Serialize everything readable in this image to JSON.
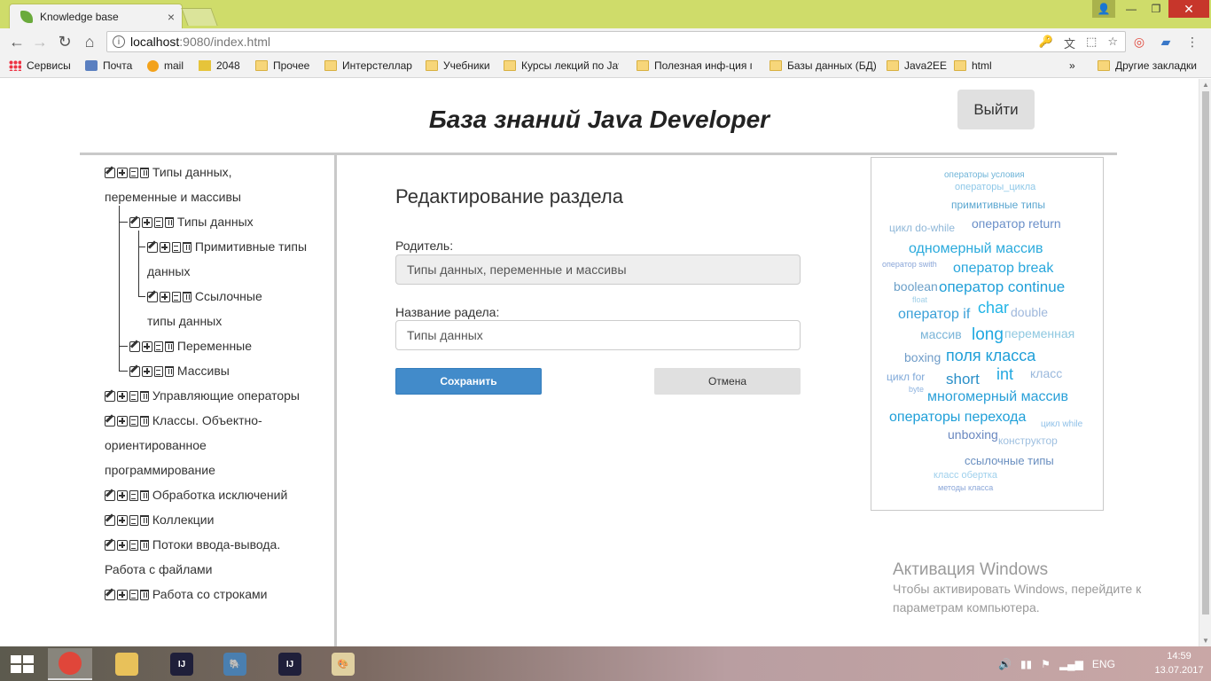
{
  "browser": {
    "tab_title": "Knowledge base",
    "tab_close": "×",
    "url_host": "localhost",
    "url_rest": ":9080/index.html",
    "window_buttons": {
      "user": "👤",
      "minimize": "—",
      "maximize": "❐",
      "close": "✕"
    },
    "nav": {
      "back": "←",
      "forward": "→",
      "reload": "↻",
      "home": "⌂"
    },
    "info_icon": "i",
    "omnibox_icons": {
      "key": "🔑",
      "translate": "文",
      "cast": "⬚",
      "star": "☆"
    }
  },
  "bookmarks": {
    "items": [
      {
        "label": "Сервисы",
        "icon": "apps-icon"
      },
      {
        "label": "Почта",
        "icon": "mail-icon"
      },
      {
        "label": "mail",
        "icon": "at-icon"
      },
      {
        "label": "2048",
        "icon": "game-icon"
      },
      {
        "label": "Прочее",
        "icon": "folder-icon"
      },
      {
        "label": "Интерстеллар",
        "icon": "folder-icon"
      },
      {
        "label": "Учебники",
        "icon": "folder-icon"
      },
      {
        "label": "Курсы лекций по Jav",
        "icon": "folder-icon"
      },
      {
        "label": "Полезная инф-ция п",
        "icon": "folder-icon"
      },
      {
        "label": "Базы данных (БД)",
        "icon": "folder-icon"
      },
      {
        "label": "Java2EE",
        "icon": "folder-icon"
      },
      {
        "label": "html",
        "icon": "folder-icon"
      }
    ],
    "more": "»",
    "other": "Другие закладки"
  },
  "page": {
    "title": "База знаний Java Developer",
    "logout_label": "Выйти"
  },
  "tree": {
    "items": [
      {
        "lines": [
          "Типы данных,",
          "переменные и массивы"
        ],
        "level": 0
      },
      {
        "lines": [
          "Типы данных"
        ],
        "level": 1
      },
      {
        "lines": [
          "Примитивные типы",
          "данных"
        ],
        "level": 2
      },
      {
        "lines": [
          "Ссылочные",
          "типы данных"
        ],
        "level": 2
      },
      {
        "lines": [
          "Переменные"
        ],
        "level": 1
      },
      {
        "lines": [
          "Массивы"
        ],
        "level": 1
      },
      {
        "lines": [
          "Управляющие операторы"
        ],
        "level": 0
      },
      {
        "lines": [
          "Классы. Объектно-",
          "ориентированное",
          "программирование"
        ],
        "level": 0
      },
      {
        "lines": [
          "Обработка исключений"
        ],
        "level": 0
      },
      {
        "lines": [
          "Коллекции"
        ],
        "level": 0
      },
      {
        "lines": [
          "Потоки ввода-вывода.",
          "Работа с файлами"
        ],
        "level": 0
      },
      {
        "lines": [
          "Работа со строками"
        ],
        "level": 0
      }
    ]
  },
  "form": {
    "title": "Редактирование раздела",
    "parent_label": "Родитель:",
    "parent_value": "Типы данных, переменные и массивы",
    "name_label": "Название радела:",
    "name_value": "Типы данных",
    "save_label": "Сохранить",
    "cancel_label": "Отмена"
  },
  "tag_cloud": {
    "tags": [
      {
        "text": "операторы условия",
        "color": "#6fb4d8",
        "size": 10
      },
      {
        "text": "операторы_цикла",
        "color": "#8fc8e8",
        "size": 11
      },
      {
        "text": "примитивные типы",
        "color": "#5aa6d0",
        "size": 12
      },
      {
        "text": "цикл do-while",
        "color": "#8fb7d8",
        "size": 12
      },
      {
        "text": "оператор return",
        "color": "#6a8fc8",
        "size": 14
      },
      {
        "text": "одномерный массив",
        "color": "#2aaadc",
        "size": 16
      },
      {
        "text": "оператор swith",
        "color": "#8aa6d8",
        "size": 9
      },
      {
        "text": "оператор break",
        "color": "#27a6dc",
        "size": 16
      },
      {
        "text": "boolean",
        "color": "#6a9fc8",
        "size": 14
      },
      {
        "text": "оператор continue",
        "color": "#1f9fd8",
        "size": 17
      },
      {
        "text": "float",
        "color": "#9fcfe8",
        "size": 9
      },
      {
        "text": "оператор if",
        "color": "#3aa0d8",
        "size": 16
      },
      {
        "text": "char",
        "color": "#22b4e6",
        "size": 18
      },
      {
        "text": "double",
        "color": "#9fb8dc",
        "size": 14
      },
      {
        "text": "массив",
        "color": "#7ab4d8",
        "size": 14
      },
      {
        "text": "long",
        "color": "#1fa8e0",
        "size": 19
      },
      {
        "text": "переменная",
        "color": "#8fc8e0",
        "size": 14
      },
      {
        "text": "boxing",
        "color": "#6f9cc8",
        "size": 14
      },
      {
        "text": "поля класса",
        "color": "#1f9fd8",
        "size": 18
      },
      {
        "text": "int",
        "color": "#22a8e0",
        "size": 18
      },
      {
        "text": "класс",
        "color": "#9ab8dc",
        "size": 14
      },
      {
        "text": "цикл for",
        "color": "#7fa8d8",
        "size": 12
      },
      {
        "text": "short",
        "color": "#2a8fc8",
        "size": 17
      },
      {
        "text": "byte",
        "color": "#8fb4e0",
        "size": 9
      },
      {
        "text": "многомерный массив",
        "color": "#2aa0d8",
        "size": 16
      },
      {
        "text": "операторы перехода",
        "color": "#1f9fd8",
        "size": 16
      },
      {
        "text": "цикл while",
        "color": "#8fc0e8",
        "size": 10
      },
      {
        "text": "unboxing",
        "color": "#6a88c0",
        "size": 14
      },
      {
        "text": "конструктор",
        "color": "#9fc0e0",
        "size": 12
      },
      {
        "text": "ссылочные типы",
        "color": "#6a8fc0",
        "size": 13
      },
      {
        "text": "класс обертка",
        "color": "#9fd0ec",
        "size": 11
      },
      {
        "text": "методы класса",
        "color": "#8aa6d8",
        "size": 9
      }
    ]
  },
  "activation": {
    "title": "Активация Windows",
    "line1": "Чтобы активировать Windows, перейдите к",
    "line2": "параметрам компьютера."
  },
  "taskbar": {
    "apps": [
      {
        "name": "chrome",
        "label": "",
        "color": "#e0463a"
      },
      {
        "name": "file-explorer",
        "label": "",
        "color": "#e8c15a"
      },
      {
        "name": "intellij-idea",
        "label": "IJ",
        "color": "#1f1f3a"
      },
      {
        "name": "pgadmin",
        "label": "🐘",
        "color": "#4a7fb0"
      },
      {
        "name": "intellij-idea-2",
        "label": "IJ",
        "color": "#1f1f3a"
      },
      {
        "name": "paint",
        "label": "🎨",
        "color": "#e0d0a0"
      }
    ],
    "tray": {
      "volume": "🔊",
      "lang": "ENG"
    },
    "time": "14:59",
    "date": "13.07.2017"
  }
}
